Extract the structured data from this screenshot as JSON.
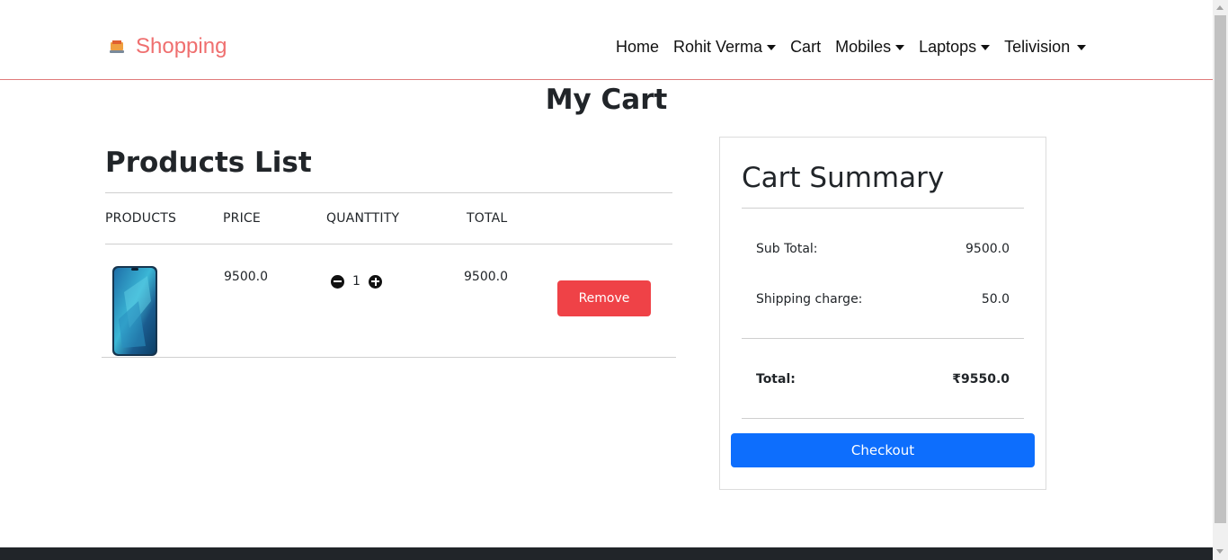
{
  "navbar": {
    "brand": "Shopping",
    "links": [
      {
        "label": "Home",
        "dropdown": false
      },
      {
        "label": "Rohit Verma",
        "dropdown": true
      },
      {
        "label": "Cart",
        "dropdown": false
      },
      {
        "label": "Mobiles",
        "dropdown": true
      },
      {
        "label": "Laptops",
        "dropdown": true
      },
      {
        "label": "Telivision",
        "dropdown": true
      }
    ]
  },
  "page": {
    "title": "My Cart"
  },
  "products": {
    "title": "Products List",
    "headers": [
      "PRODUCTS",
      "PRICE",
      "QUANTTITY",
      "TOTAL"
    ],
    "items": [
      {
        "price": "9500.0",
        "quantity": "1",
        "total": "9500.0",
        "remove_label": "Remove"
      }
    ]
  },
  "summary": {
    "title": "Cart Summary",
    "subtotal_label": "Sub Total:",
    "subtotal_value": "9500.0",
    "shipping_label": "Shipping charge:",
    "shipping_value": "50.0",
    "total_label": "Total:",
    "total_value": "₹9550.0",
    "checkout_label": "Checkout"
  },
  "colors": {
    "brand": "#ef6f6f",
    "remove": "#ef4247",
    "checkout": "#0d6efd",
    "footer": "#212529"
  }
}
